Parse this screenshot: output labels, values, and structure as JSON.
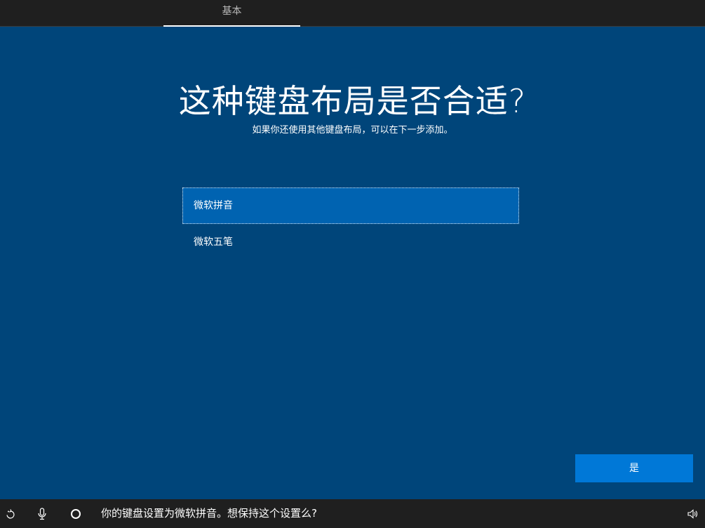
{
  "header": {
    "tab_label": "基本"
  },
  "main": {
    "title": "这种键盘布局是否合适?",
    "subtitle": "如果你还使用其他键盘布局，可以在下一步添加。",
    "options": [
      {
        "label": "微软拼音",
        "selected": true
      },
      {
        "label": "微软五笔",
        "selected": false
      }
    ],
    "yes_button": "是"
  },
  "taskbar": {
    "icons": [
      "accessibility-icon",
      "microphone-icon",
      "cortana-icon",
      "volume-icon"
    ],
    "message": "你的键盘设置为微软拼音。想保持这个设置么?"
  },
  "colors": {
    "background": "#00457a",
    "bar": "#1f1f1f",
    "selected_option": "#0063b1",
    "accent_button": "#0078d7"
  }
}
